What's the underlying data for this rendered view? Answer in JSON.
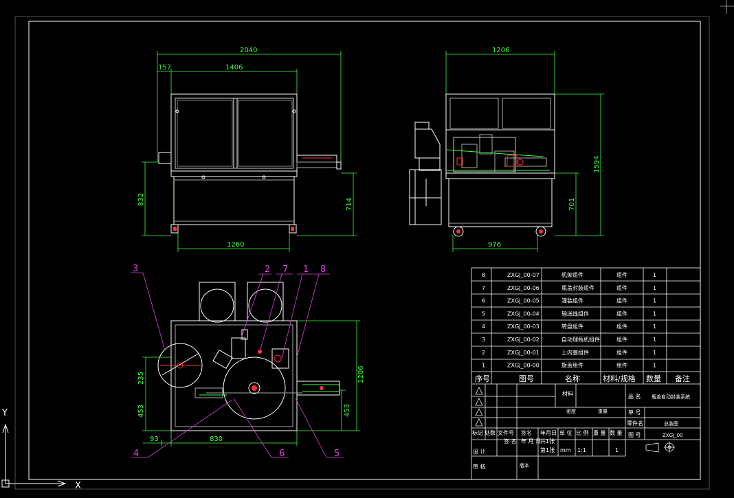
{
  "dimensions": {
    "front_total_width": "2040",
    "front_left_offset": "157",
    "front_frame_width": "1406",
    "front_total_height": "832",
    "front_table_height": "714",
    "front_base_width": "1260",
    "side_width": "1206",
    "side_total_height": "1594",
    "side_table_height": "701",
    "side_base_width": "976",
    "top_depth": "1206",
    "top_upper": "235",
    "top_lower_left": "453",
    "top_lower_right": "453",
    "top_left_offset": "93",
    "top_width": "830"
  },
  "balloons": [
    "3",
    "2",
    "7",
    "1",
    "8",
    "4",
    "6",
    "5"
  ],
  "parts_list": {
    "rows": [
      {
        "no": "8",
        "code": "ZXGJ_00-07",
        "name": "机架组件",
        "material": "组件",
        "qty": "1"
      },
      {
        "no": "7",
        "code": "ZXGJ_00-06",
        "name": "瓶盖封装组件",
        "material": "组件",
        "qty": "1"
      },
      {
        "no": "6",
        "code": "ZXGJ_00-05",
        "name": "灌装组件",
        "material": "组件",
        "qty": "1"
      },
      {
        "no": "5",
        "code": "ZXGJ_00-04",
        "name": "输送线组件",
        "material": "组件",
        "qty": "1"
      },
      {
        "no": "4",
        "code": "ZXGJ_00-03",
        "name": "转盘组件",
        "material": "组件",
        "qty": "1"
      },
      {
        "no": "3",
        "code": "ZXGJ_00-02",
        "name": "自动理瓶机组件",
        "material": "组件",
        "qty": "1"
      },
      {
        "no": "2",
        "code": "ZXGJ_00-01",
        "name": "上内塞组件",
        "material": "组件",
        "qty": "1"
      },
      {
        "no": "1",
        "code": "ZXGJ_00-00",
        "name": "旋盖组件",
        "material": "组件",
        "qty": "1"
      }
    ],
    "headers": {
      "no": "序号",
      "code": "图号",
      "name": "名称",
      "material": "材料/规格",
      "qty": "数量",
      "note": "备注"
    }
  },
  "title_block": {
    "material_label": "材料",
    "product_name_label": "品 名",
    "product_name": "瓶盖自动封装系统",
    "density": "密度",
    "weight": "重量",
    "unit_label": "单 号",
    "part_name_label": "零件名",
    "part_name": "总装图",
    "drawing_no_label": "图 号",
    "drawing_no": "ZXGJ_00",
    "rev_row": [
      "标记",
      "处数",
      "文件号",
      "签名",
      "年月日"
    ],
    "sign_row": [
      "签 名",
      "年 月 日"
    ],
    "unit_cols": [
      "单 位",
      "比 例",
      "重 量",
      "数 量"
    ],
    "sheets_total": "共1张",
    "sheet_no": "第1张",
    "unit_value": "mm",
    "scale": "1:1",
    "qty_value": "1",
    "design_label": "设 计",
    "review_label": "审 核",
    "version_label": "版本"
  },
  "ucs": {
    "y": "Y",
    "x": "X"
  },
  "colors": {
    "background": "#000000",
    "frame": "#ffffff",
    "dimension": "#3cff3c",
    "balloon": "#e040e0",
    "part_red": "#ff3030",
    "hidden": "#c8c8c8"
  }
}
